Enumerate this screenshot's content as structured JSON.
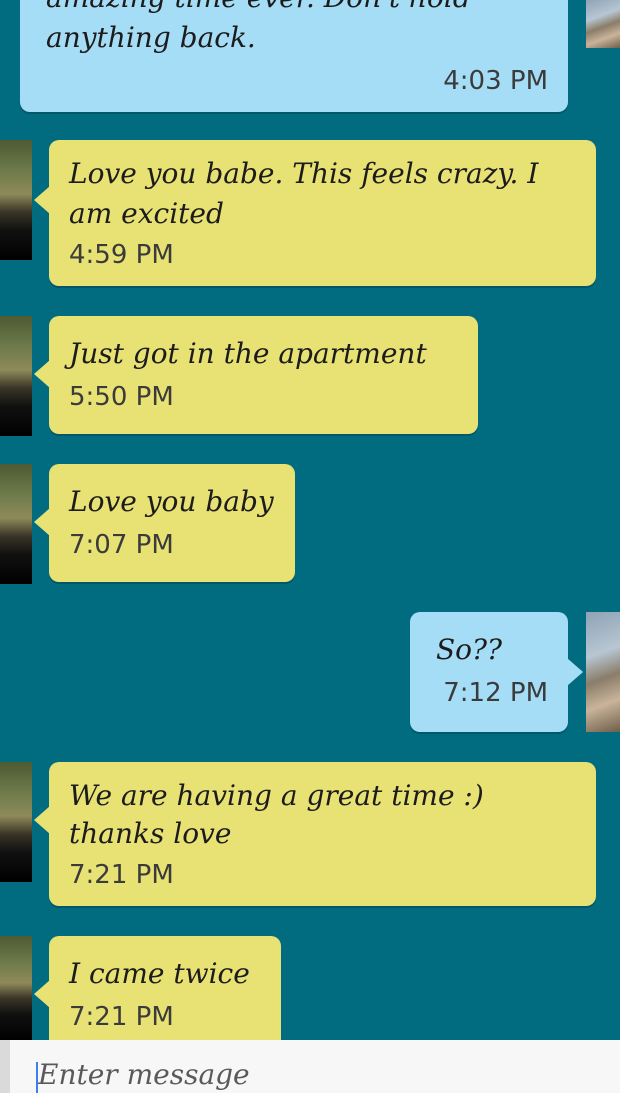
{
  "conversation": {
    "messages": [
      {
        "direction": "outgoing",
        "text_top": "amazing time ever. Don't hold",
        "text": "anything back.",
        "time": "4:03 PM"
      },
      {
        "direction": "incoming",
        "text_line1": "Love you babe. This feels crazy. I",
        "text_line2": "am excited",
        "time": "4:59 PM"
      },
      {
        "direction": "incoming",
        "text": "Just got in the apartment",
        "time": "5:50 PM"
      },
      {
        "direction": "incoming",
        "text": "Love you baby",
        "time": "7:07 PM"
      },
      {
        "direction": "outgoing",
        "text": "So??",
        "time": "7:12 PM"
      },
      {
        "direction": "incoming",
        "text_line1": "We are having a great time :)",
        "text_line2": "thanks love",
        "time": "7:21 PM"
      },
      {
        "direction": "incoming",
        "text": "I came twice",
        "time": "7:21 PM"
      }
    ]
  },
  "composer": {
    "placeholder": "Enter message"
  }
}
